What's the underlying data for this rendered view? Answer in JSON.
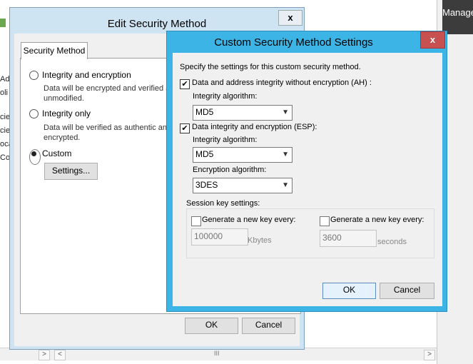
{
  "background": {
    "manage_label": "Manage",
    "left_fragments": [
      "Adv",
      "oli",
      "cie",
      "cie",
      "oca",
      "Cor"
    ]
  },
  "edit_dialog": {
    "title": "Edit Security Method",
    "close_glyph": "x",
    "tab_label": "Security Method",
    "options": [
      {
        "label": "Integrity and encryption",
        "desc_line1": "Data will be encrypted and verified a",
        "desc_line2": "unmodified."
      },
      {
        "label": "Integrity only",
        "desc_line1": "Data will be verified as authentic and",
        "desc_line2": "encrypted."
      },
      {
        "label": "Custom"
      }
    ],
    "selected_option": "Custom",
    "settings_button": "Settings...",
    "ok_button": "OK",
    "cancel_button": "Cancel"
  },
  "custom_dialog": {
    "title": "Custom Security Method Settings",
    "close_glyph": "x",
    "instruction": "Specify the settings for this custom security method.",
    "ah": {
      "checked": true,
      "label": "Data and address integrity without encryption (AH) :",
      "integrity_label": "Integrity algorithm:",
      "integrity_value": "MD5"
    },
    "esp": {
      "checked": true,
      "label": "Data integrity and encryption (ESP):",
      "integrity_label": "Integrity algorithm:",
      "integrity_value": "MD5",
      "encryption_label": "Encryption algorithm:",
      "encryption_value": "3DES"
    },
    "session": {
      "group_label": "Session key settings:",
      "kbytes_check_label": "Generate a new key every:",
      "kbytes_checked": false,
      "kbytes_value": "100000",
      "kbytes_unit": "Kbytes",
      "seconds_check_label": "Generate a new key every:",
      "seconds_checked": false,
      "seconds_value": "3600",
      "seconds_unit": "seconds"
    },
    "ok_button": "OK",
    "cancel_button": "Cancel"
  },
  "scrollbar": {
    "left_arrow": "<",
    "right_arrow": ">",
    "grip": "III"
  }
}
